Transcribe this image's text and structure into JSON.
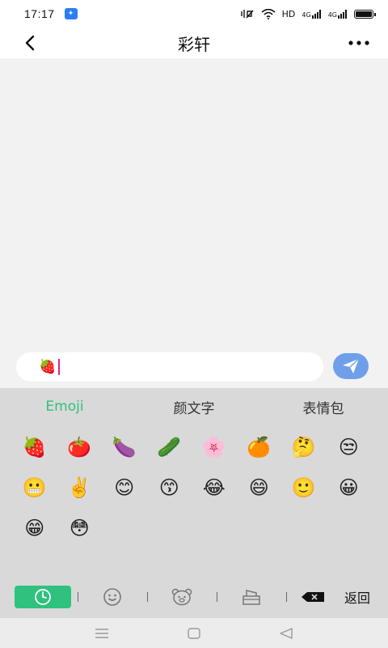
{
  "status_bar": {
    "time": "17:17",
    "hd_label": "HD",
    "signal1_label": "4G",
    "signal2_label": "4G",
    "battery_level": 1.0
  },
  "nav": {
    "title": "彩轩"
  },
  "input": {
    "value": "🍓",
    "icons": {
      "send": "send-icon"
    }
  },
  "emoji_panel": {
    "tabs": [
      {
        "label": "Emoji",
        "active": true
      },
      {
        "label": "颜文字",
        "active": false
      },
      {
        "label": "表情包",
        "active": false
      }
    ],
    "emojis": [
      "🍓",
      "🍅",
      "🍆",
      "🥒",
      "🌸",
      "🍊",
      "🤔",
      "😒",
      "😬",
      "✌️",
      "😊",
      "😙",
      "😂",
      "😄",
      "🙂",
      "😀",
      "😁",
      "😳"
    ],
    "toolbar": {
      "return_label": "返回",
      "icons": [
        "clock-icon",
        "smiley-icon",
        "bear-icon",
        "cake-icon",
        "delete-icon"
      ]
    }
  },
  "colors": {
    "accent_green": "#2ec27e",
    "send_blue": "#6f9fe8",
    "chat_bg": "#f2f2f2",
    "panel_bg": "#d9d9d9"
  }
}
